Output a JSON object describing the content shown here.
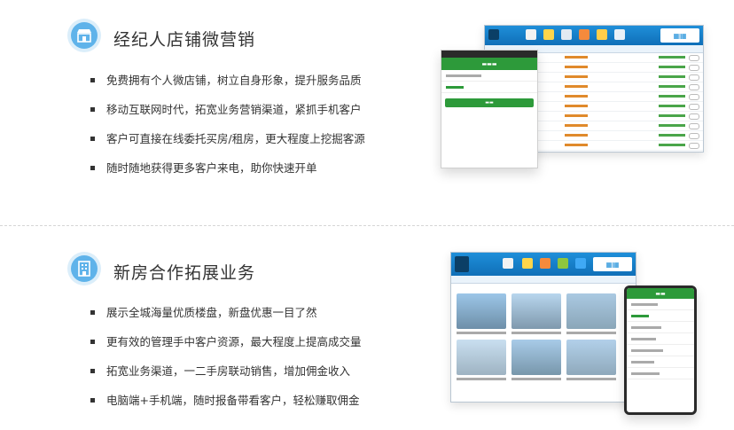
{
  "section1": {
    "title": "经纪人店铺微营销",
    "icon": "storefront-icon",
    "bullets": [
      "免费拥有个人微店铺，树立自身形象，提升服务品质",
      "移动互联网时代，拓宽业务营销渠道，紧抓手机客户",
      "客户可直接在线委托买房/租房，更大程度上挖掘客源",
      "随时随地获得更多客户来电，助你快速开单"
    ]
  },
  "section2": {
    "title": "新房合作拓展业务",
    "icon": "building-icon",
    "bullets": [
      "展示全城海量优质楼盘，新盘优惠一目了然",
      "更有效的管理手中客户资源，最大程度上提高成交量",
      "拓宽业务渠道，一二手房联动销售，增加佣金收入",
      "电脑端+手机端，随时报备带看客户，轻松赚取佣金"
    ]
  },
  "colors": {
    "icon_bg": "#5fb3ea",
    "app_blue": "#1f8fd9",
    "app_green": "#2d9a3a"
  }
}
